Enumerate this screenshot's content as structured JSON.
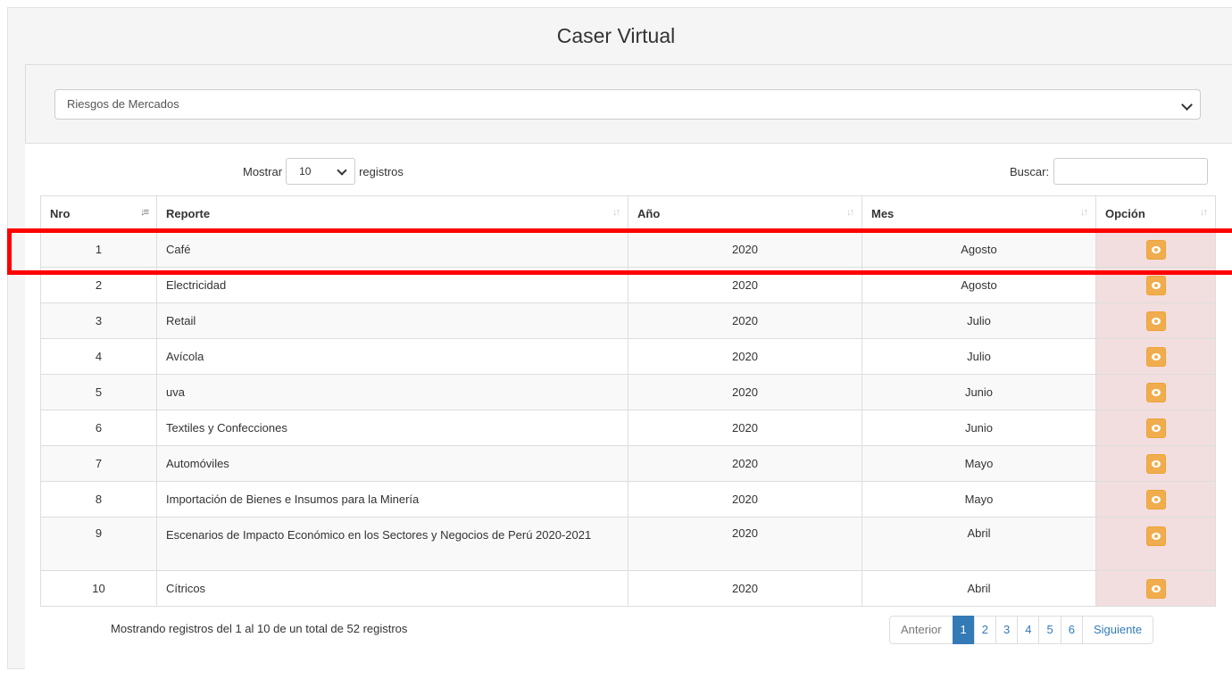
{
  "header": {
    "title": "Caser Virtual"
  },
  "filter": {
    "selected": "Riesgos de Mercados"
  },
  "controls": {
    "show_prefix": "Mostrar",
    "page_size": "10",
    "show_suffix": "registros",
    "search_label": "Buscar:",
    "search_value": ""
  },
  "table": {
    "headers": {
      "nro": "Nro",
      "reporte": "Reporte",
      "anio": "Año",
      "mes": "Mes",
      "opcion": "Opción"
    },
    "rows": [
      {
        "nro": "1",
        "reporte": "Café",
        "anio": "2020",
        "mes": "Agosto"
      },
      {
        "nro": "2",
        "reporte": "Electricidad",
        "anio": "2020",
        "mes": "Agosto"
      },
      {
        "nro": "3",
        "reporte": "Retail",
        "anio": "2020",
        "mes": "Julio"
      },
      {
        "nro": "4",
        "reporte": "Avícola",
        "anio": "2020",
        "mes": "Julio"
      },
      {
        "nro": "5",
        "reporte": "uva",
        "anio": "2020",
        "mes": "Junio"
      },
      {
        "nro": "6",
        "reporte": "Textiles y Confecciones",
        "anio": "2020",
        "mes": "Junio"
      },
      {
        "nro": "7",
        "reporte": "Automóviles",
        "anio": "2020",
        "mes": "Mayo"
      },
      {
        "nro": "8",
        "reporte": "Importación de Bienes e Insumos para la Minería",
        "anio": "2020",
        "mes": "Mayo"
      },
      {
        "nro": "9",
        "reporte": "Escenarios de Impacto Económico en los Sectores y Negocios de Perú 2020-2021",
        "anio": "2020",
        "mes": "Abril"
      },
      {
        "nro": "10",
        "reporte": "Cítricos",
        "anio": "2020",
        "mes": "Abril"
      }
    ]
  },
  "footer": {
    "info": "Mostrando registros del 1 al 10 de un total de 52 registros",
    "prev": "Anterior",
    "pages": [
      "1",
      "2",
      "3",
      "4",
      "5",
      "6"
    ],
    "next": "Siguiente"
  },
  "colors": {
    "highlight": "#ff0000",
    "option_cell": "#f2dede",
    "view_button": "#f0ad4e",
    "active_page": "#337ab7"
  }
}
